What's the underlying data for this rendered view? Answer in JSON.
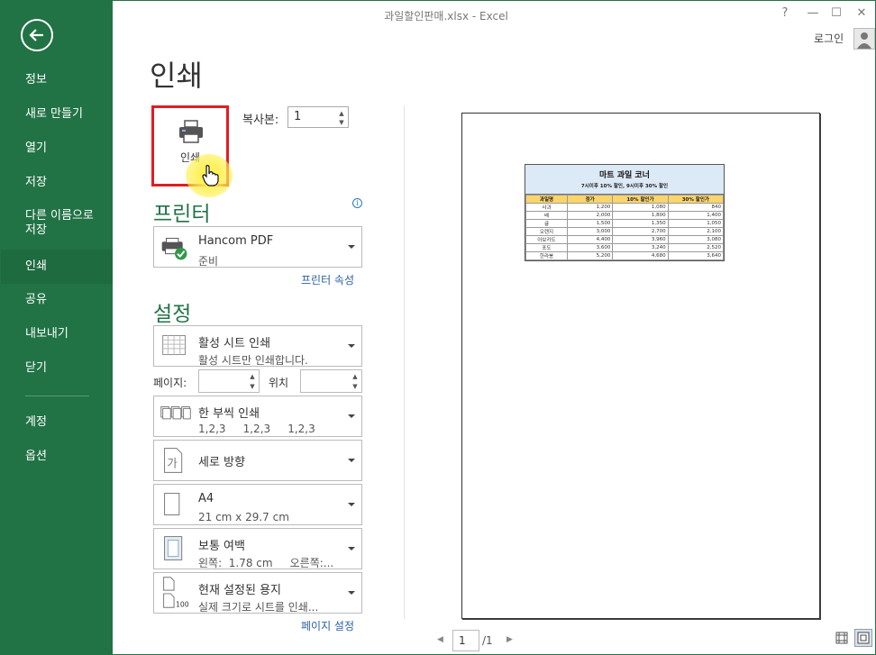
{
  "window": {
    "title": "과일할인판매.xlsx - Excel",
    "help": "?",
    "minimize": "—",
    "maximize": "☐",
    "close": "✕",
    "login": "로그인"
  },
  "sidebar": {
    "items": [
      {
        "label": "정보"
      },
      {
        "label": "새로 만들기"
      },
      {
        "label": "열기"
      },
      {
        "label": "저장"
      },
      {
        "label": "다른 이름으로\n저장"
      },
      {
        "label": "인쇄"
      },
      {
        "label": "공유"
      },
      {
        "label": "내보내기"
      },
      {
        "label": "닫기"
      },
      {
        "label": "계정"
      },
      {
        "label": "옵션"
      }
    ],
    "active": "인쇄"
  },
  "main": {
    "title": "인쇄",
    "print_button": "인쇄",
    "copies_label": "복사본:",
    "copies_value": "1",
    "printer_heading": "프린터",
    "printer": {
      "name": "Hancom PDF",
      "status": "준비"
    },
    "printer_props": "프린터 속성",
    "settings_heading": "설정",
    "settings": {
      "what": {
        "t1": "활성 시트 인쇄",
        "t2": "활성 시트만 인쇄합니다."
      },
      "pages_label": "페이지:",
      "to_label": "위치",
      "collate": {
        "t1": "한 부씩 인쇄",
        "t2": "1,2,3     1,2,3     1,2,3"
      },
      "orientation": {
        "t1": "세로 방향"
      },
      "paper": {
        "t1": "A4",
        "t2": "21 cm x 29.7 cm"
      },
      "margins": {
        "t1": "보통 여백",
        "t2": "왼쪽:  1.78 cm     오른쪽:..."
      },
      "scaling": {
        "t1": "현재 설정된 용지",
        "t2": "실제 크기로 시트를 인쇄..."
      }
    },
    "page_setup": "페이지 설정"
  },
  "preview": {
    "sheet_title": "마트 과일 코너",
    "sheet_subtitle": "7시이후 10% 할인, 9시이후 30% 할인",
    "headers": [
      "과일명",
      "정가",
      "10% 할인가",
      "30% 할인가"
    ],
    "rows": [
      [
        "사과",
        "1,200",
        "1,080",
        "840"
      ],
      [
        "배",
        "2,000",
        "1,800",
        "1,400"
      ],
      [
        "귤",
        "1,500",
        "1,350",
        "1,050"
      ],
      [
        "오렌지",
        "3,000",
        "2,700",
        "2,100"
      ],
      [
        "아보카도",
        "4,400",
        "3,960",
        "3,080"
      ],
      [
        "포도",
        "3,600",
        "3,240",
        "2,520"
      ],
      [
        "한라봉",
        "5,200",
        "4,680",
        "3,640"
      ]
    ],
    "page_current": "1",
    "page_total": "/1"
  }
}
